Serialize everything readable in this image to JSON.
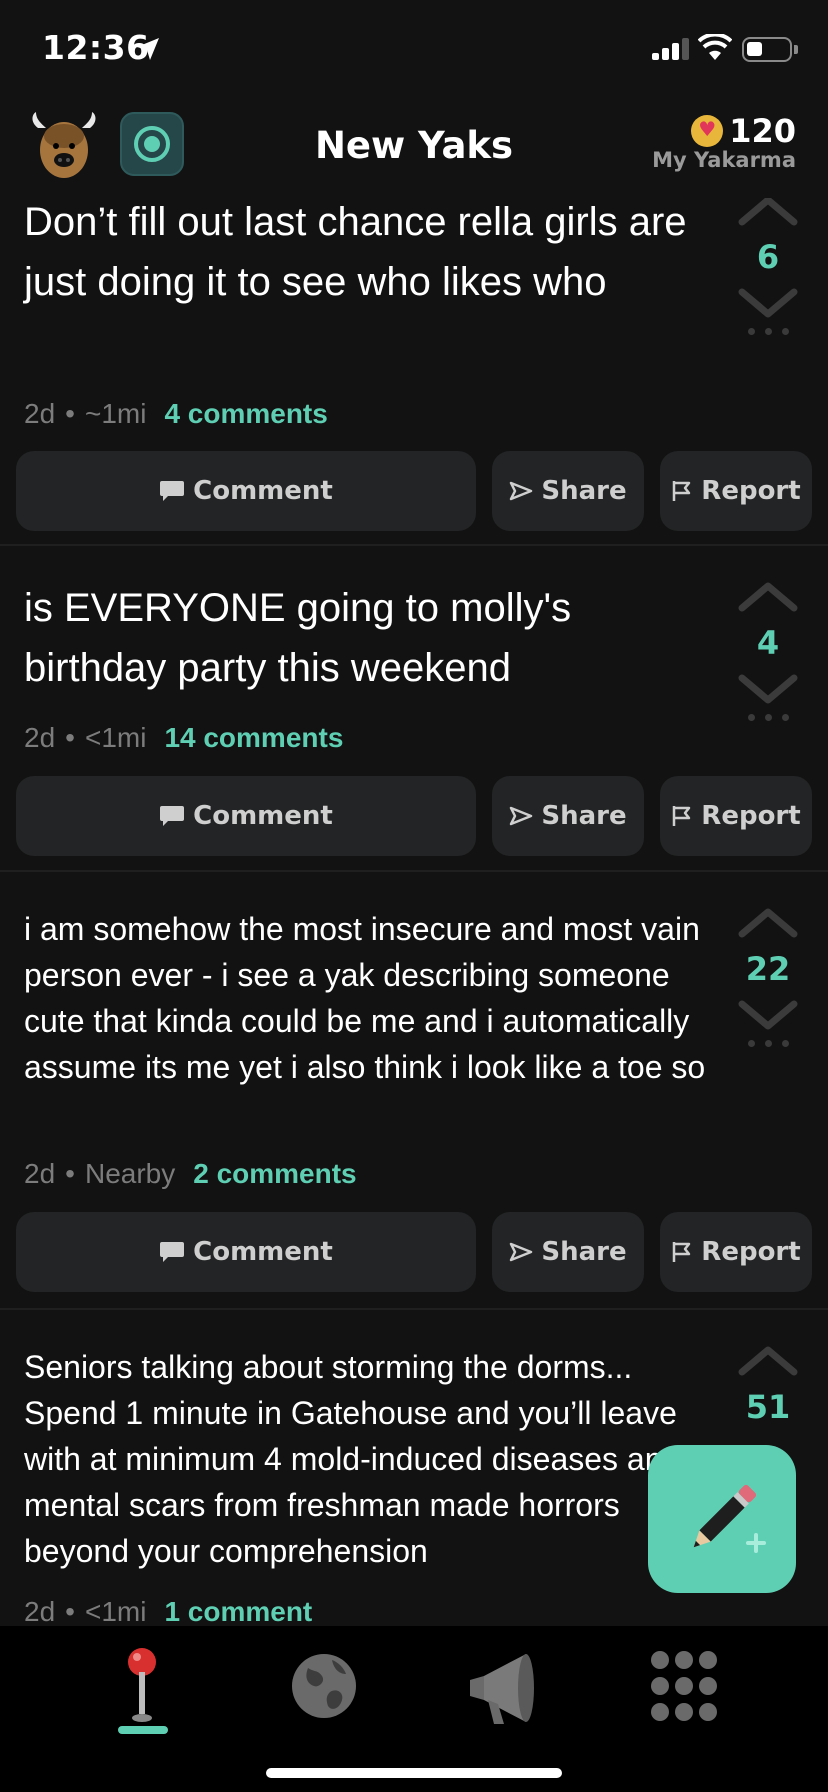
{
  "status_bar": {
    "time": "12:36"
  },
  "header": {
    "title": "New Yaks",
    "yakarma_value": "120",
    "yakarma_label": "My Yakarma"
  },
  "actions": {
    "comment": "Comment",
    "share": "Share",
    "report": "Report"
  },
  "posts": [
    {
      "text": "Don’t fill out last chance rella girls are just doing it to see who likes who",
      "age": "2d",
      "distance": "~1mi",
      "comments": "4 comments",
      "votes": "6"
    },
    {
      "text": "is EVERYONE going to molly's birthday party this weekend",
      "age": "2d",
      "distance": "<1mi",
      "comments": "14 comments",
      "votes": "4"
    },
    {
      "text": "i am somehow the most insecure and most vain person ever - i see a yak describing someone cute that kinda could be me and i automatically assume its me yet i also think i look like a toe so",
      "age": "2d",
      "distance": "Nearby",
      "comments": "2 comments",
      "votes": "22"
    },
    {
      "text": "Seniors talking about storming the dorms... Spend 1 minute in Gatehouse and you’ll leave with at minimum 4 mold-induced diseases and mental scars from freshman made horrors beyond your comprehension",
      "age": "2d",
      "distance": "<1mi",
      "comments": "1 comment",
      "votes": "51"
    }
  ],
  "separator": "•",
  "tabs": [
    "joystick-icon",
    "globe-icon",
    "megaphone-icon",
    "grid-icon"
  ],
  "colors": {
    "accent": "#5fcfb3",
    "background": "#121212",
    "button": "#232425"
  }
}
